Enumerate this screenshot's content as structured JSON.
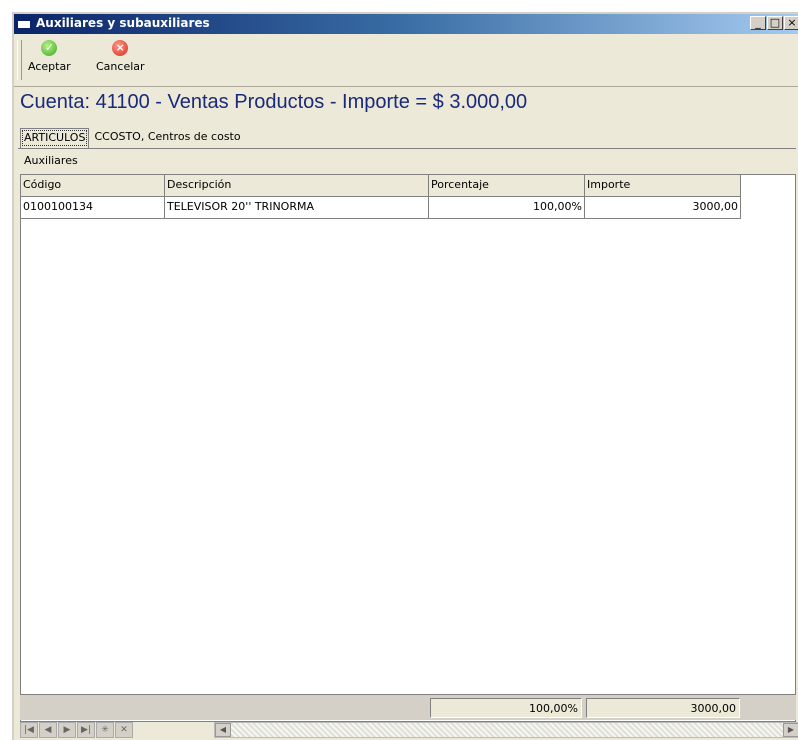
{
  "window": {
    "title": "Auxiliares y subauxiliares",
    "controls": [
      "_",
      "□",
      "×"
    ]
  },
  "toolbar": {
    "accept_label": "Aceptar",
    "accept_icon": "check-circle-icon",
    "cancel_label": "Cancelar",
    "cancel_icon": "x-circle-icon"
  },
  "heading": "Cuenta: 41100 - Ventas Productos - Importe = $  3.000,00",
  "tabs": [
    {
      "label": "ARTICULOS",
      "active": true
    },
    {
      "label": "CCOSTO, Centros de costo",
      "active": false
    }
  ],
  "section_label": "Auxiliares",
  "table": {
    "columns": [
      "Código",
      "Descripción",
      "Porcentaje",
      "Importe"
    ],
    "rows": [
      {
        "codigo": "0100100134",
        "descripcion": "TELEVISOR 20'' TRINORMA",
        "porcentaje": "100,00%",
        "importe": "3000,00"
      }
    ],
    "totals": {
      "porcentaje": "100,00%",
      "importe": "3000,00"
    }
  },
  "navigator": {
    "buttons": [
      "first",
      "prior",
      "next",
      "last",
      "insert",
      "delete"
    ],
    "glyphs": [
      "|◀",
      "◀",
      "▶",
      "▶|",
      "✳",
      "✕"
    ]
  },
  "scroll": {
    "left": "◀",
    "right": "▶"
  }
}
